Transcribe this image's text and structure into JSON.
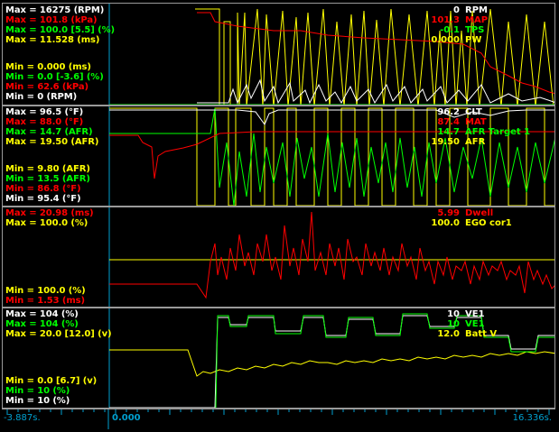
{
  "colors": {
    "white": "#ffffff",
    "red": "#ff0000",
    "green": "#00ff00",
    "yellow": "#ffff00",
    "cyan": "#00a0d0"
  },
  "panel1": {
    "left": [
      {
        "text": "Max = 16275 (RPM)",
        "color": "white"
      },
      {
        "text": "Max = 101.8 (kPa)",
        "color": "red"
      },
      {
        "text": "Max = 100.0 [5.5] (%)",
        "color": "green"
      },
      {
        "text": "Max = 11.528 (ms)",
        "color": "yellow"
      },
      {
        "text": "Min = 0.000 (ms)",
        "color": "yellow"
      },
      {
        "text": "Min = 0.0 [-3.6] (%)",
        "color": "green"
      },
      {
        "text": "Min = 62.6 (kPa)",
        "color": "red"
      },
      {
        "text": "Min = 0 (RPM)",
        "color": "white"
      }
    ],
    "right": [
      {
        "value": "0",
        "name": "RPM",
        "color": "white"
      },
      {
        "value": "101.3",
        "name": "MAP",
        "color": "red"
      },
      {
        "value": "-0.1",
        "name": "TPS",
        "color": "green"
      },
      {
        "value": "0.000",
        "name": "PW",
        "color": "yellow"
      }
    ]
  },
  "panel2": {
    "left": [
      {
        "text": "Max = 96.5 (°F)",
        "color": "white"
      },
      {
        "text": "Max = 88.0 (°F)",
        "color": "red"
      },
      {
        "text": "Max = 14.7 (AFR)",
        "color": "green"
      },
      {
        "text": "Max = 19.50 (AFR)",
        "color": "yellow"
      },
      {
        "text": "Min = 9.80 (AFR)",
        "color": "yellow"
      },
      {
        "text": "Min = 13.5 (AFR)",
        "color": "green"
      },
      {
        "text": "Min = 86.8 (°F)",
        "color": "red"
      },
      {
        "text": "Min = 95.4 (°F)",
        "color": "white"
      }
    ],
    "right": [
      {
        "value": "96.2",
        "name": "CLT",
        "color": "white"
      },
      {
        "value": "87.4",
        "name": "MAT",
        "color": "red"
      },
      {
        "value": "14.7",
        "name": "AFR Target 1",
        "color": "green"
      },
      {
        "value": "19.50",
        "name": "AFR",
        "color": "yellow"
      }
    ]
  },
  "panel3": {
    "left": [
      {
        "text": "Max = 20.98 (ms)",
        "color": "red"
      },
      {
        "text": "Max = 100.0 (%)",
        "color": "yellow"
      },
      {
        "text": "Min = 100.0 (%)",
        "color": "yellow"
      },
      {
        "text": "Min = 1.53 (ms)",
        "color": "red"
      }
    ],
    "right": [
      {
        "value": "5.99",
        "name": "Dwell",
        "color": "red"
      },
      {
        "value": "100.0",
        "name": "EGO cor1",
        "color": "yellow"
      }
    ]
  },
  "panel4": {
    "left": [
      {
        "text": "Max = 104 (%)",
        "color": "white"
      },
      {
        "text": "Max = 104 (%)",
        "color": "green"
      },
      {
        "text": "Max = 20.0 [12.0] (v)",
        "color": "yellow"
      },
      {
        "text": "Min = 0.0 [6.7] (v)",
        "color": "yellow"
      },
      {
        "text": "Min = 10 (%)",
        "color": "green"
      },
      {
        "text": "Min = 10 (%)",
        "color": "white"
      }
    ],
    "right": [
      {
        "value": "10",
        "name": "VE1",
        "color": "white"
      },
      {
        "value": "10",
        "name": "VE1",
        "color": "green"
      },
      {
        "value": "12.0",
        "name": "Batt V",
        "color": "yellow"
      }
    ]
  },
  "statusbar": {
    "left_time": "-3.887s.",
    "cursor_time": "0.000",
    "right_time": "16.336s."
  }
}
